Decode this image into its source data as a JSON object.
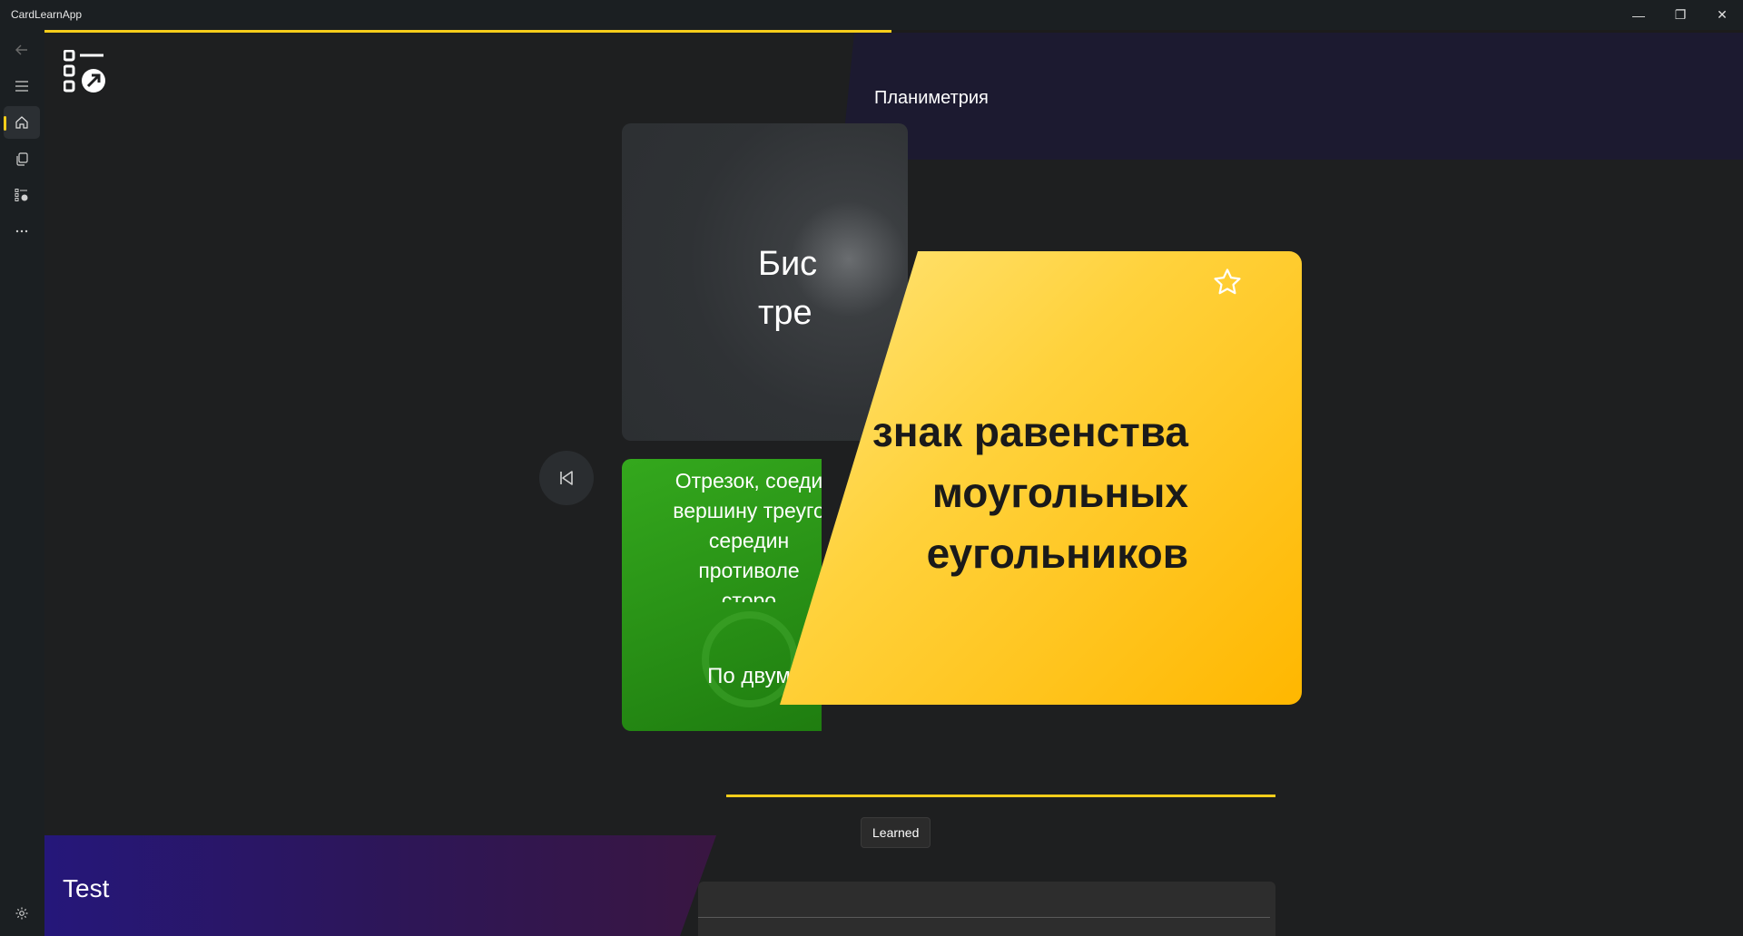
{
  "window": {
    "title": "CardLearnApp",
    "minimize_glyph": "—",
    "maximize_glyph": "❐",
    "close_glyph": "✕"
  },
  "nav": {
    "items": [
      {
        "name": "back",
        "icon": "back-arrow-icon"
      },
      {
        "name": "menu",
        "icon": "hamburger-icon"
      },
      {
        "name": "home",
        "icon": "home-icon",
        "active": true
      },
      {
        "name": "cards",
        "icon": "cards-copy-icon"
      },
      {
        "name": "quiz",
        "icon": "list-check-icon"
      },
      {
        "name": "more",
        "icon": "more-icon"
      },
      {
        "name": "settings",
        "icon": "gear-icon"
      }
    ]
  },
  "deck": {
    "title": "Планиметрия"
  },
  "cards": {
    "back_card_text": "Бис\nтре",
    "green_definition": "Отрезок, соеди\nвершину треуго\nсередин\nпротиволе\nсторо",
    "green_answer": "По двум",
    "yellow_question": "знак равенства\nмоугольных\nеугольников"
  },
  "controls": {
    "learned_tooltip": "Learned"
  },
  "test": {
    "title": "Test"
  },
  "colors": {
    "accent": "#f6cd1a",
    "card_yellow": "#ffd23c",
    "card_green": "#2e9a17",
    "header_purple": "#1c1a30"
  }
}
